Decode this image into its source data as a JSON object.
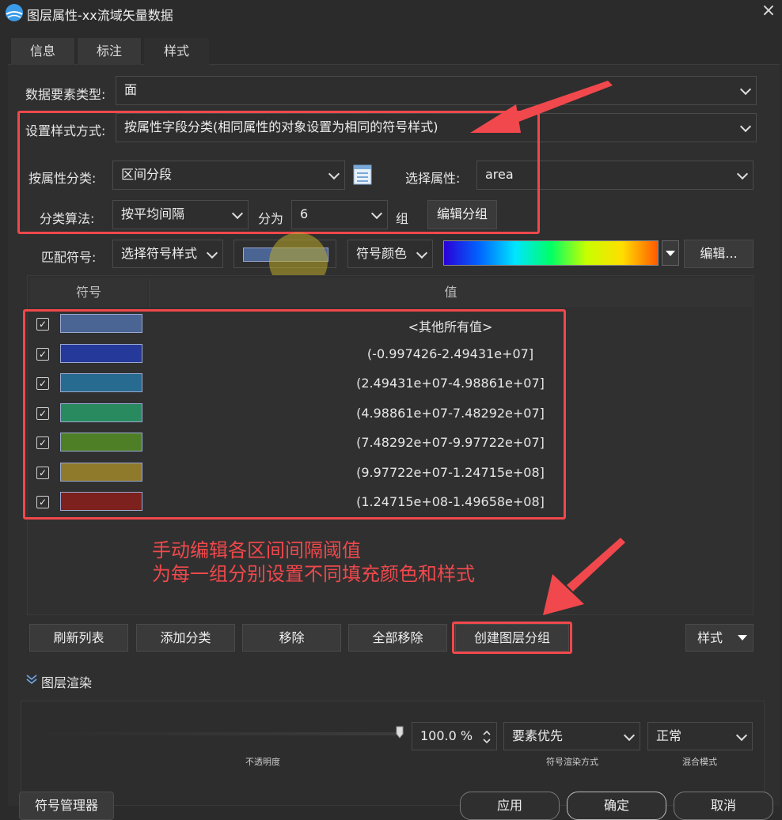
{
  "window": {
    "title": "图层属性-xx流域矢量数据",
    "close_icon": "×"
  },
  "tabs": [
    {
      "label": "信息"
    },
    {
      "label": "标注"
    },
    {
      "label": "样式"
    }
  ],
  "form": {
    "feature_type_label": "数据要素类型:",
    "feature_type_value": "面",
    "style_mode_label": "设置样式方式:",
    "style_mode_value": "按属性字段分类(相同属性的对象设置为相同的符号样式)",
    "classify_label": "按属性分类:",
    "classify_value": "区间分段",
    "attr_label": "选择属性:",
    "attr_value": "area",
    "algo_label": "分类算法:",
    "algo_value": "按平均间隔",
    "split_label": "分为",
    "split_value": "6",
    "group_label": "组",
    "edit_group_button": "编辑分组",
    "match_label": "匹配符号:",
    "symbol_style_value": "选择符号样式",
    "symbol_color_value": "符号颜色",
    "edit_button": "编辑..."
  },
  "table": {
    "col_symbol": "符号",
    "col_value": "值",
    "rows": [
      {
        "value": "<其他所有值>",
        "color": "#4a6494"
      },
      {
        "value": "(-0.997426-2.49431e+07]",
        "color": "#25399a"
      },
      {
        "value": "(2.49431e+07-4.98861e+07]",
        "color": "#276b90"
      },
      {
        "value": "(4.98861e+07-7.48292e+07]",
        "color": "#298a5f"
      },
      {
        "value": "(7.48292e+07-9.97722e+07]",
        "color": "#4e7f27"
      },
      {
        "value": "(9.97722e+07-1.24715e+08]",
        "color": "#8f7a2b"
      },
      {
        "value": "(1.24715e+08-1.49658e+08]",
        "color": "#7c211e"
      }
    ],
    "check_mark": "✓"
  },
  "annotation": {
    "line1": "手动编辑各区间间隔阈值",
    "line2": "为每一组分别设置不同填充颜色和样式"
  },
  "actions": {
    "refresh": "刷新列表",
    "add": "添加分类",
    "remove": "移除",
    "remove_all": "全部移除",
    "create_group": "创建图层分组",
    "style": "样式"
  },
  "render": {
    "section_title": "图层渲染",
    "opacity_value": "100.0 %",
    "opacity_label": "不透明度",
    "opacity_fraction": 1.0,
    "render_mode_value": "要素优先",
    "render_mode_label": "符号渲染方式",
    "blend_value": "正常",
    "blend_label": "混合模式"
  },
  "footer": {
    "symbol_manager": "符号管理器",
    "apply": "应用",
    "ok": "确定",
    "cancel": "取消"
  },
  "colors": {
    "accent_red": "#f0484c"
  }
}
